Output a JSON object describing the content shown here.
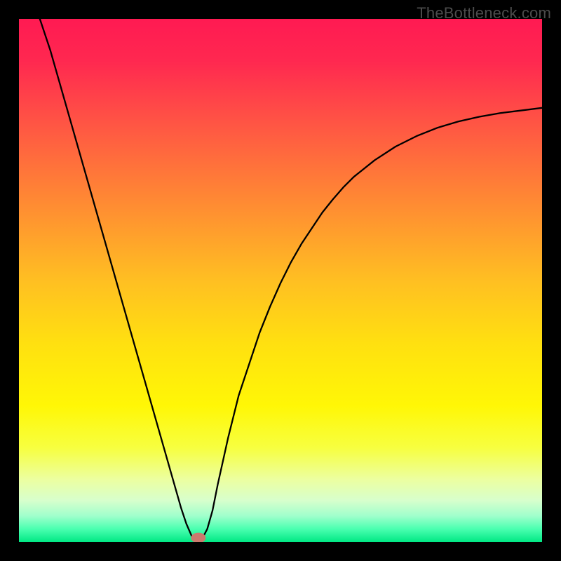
{
  "watermark": "TheBottleneck.com",
  "chart_data": {
    "type": "line",
    "title": "",
    "xlabel": "",
    "ylabel": "",
    "xlim": [
      0,
      100
    ],
    "ylim": [
      0,
      100
    ],
    "grid": false,
    "legend": false,
    "background": {
      "type": "vertical-gradient",
      "stops": [
        {
          "pos": 0.0,
          "color": "#ff1a52"
        },
        {
          "pos": 0.08,
          "color": "#ff2850"
        },
        {
          "pos": 0.2,
          "color": "#ff5544"
        },
        {
          "pos": 0.35,
          "color": "#ff8a33"
        },
        {
          "pos": 0.5,
          "color": "#ffbf22"
        },
        {
          "pos": 0.62,
          "color": "#ffe010"
        },
        {
          "pos": 0.74,
          "color": "#fff706"
        },
        {
          "pos": 0.82,
          "color": "#f7ff40"
        },
        {
          "pos": 0.88,
          "color": "#ecffa0"
        },
        {
          "pos": 0.92,
          "color": "#d8ffcc"
        },
        {
          "pos": 0.95,
          "color": "#a0ffcc"
        },
        {
          "pos": 0.975,
          "color": "#4affb0"
        },
        {
          "pos": 1.0,
          "color": "#00e884"
        }
      ]
    },
    "series": [
      {
        "name": "bottleneck-curve",
        "color": "#000000",
        "stroke_width": 2.3,
        "x": [
          4,
          6,
          8,
          10,
          12,
          14,
          16,
          18,
          20,
          22,
          24,
          26,
          28,
          29,
          30,
          31,
          32,
          33,
          34,
          35,
          36,
          37,
          38,
          40,
          42,
          44,
          46,
          48,
          50,
          52,
          54,
          56,
          58,
          60,
          62,
          64,
          68,
          72,
          76,
          80,
          84,
          88,
          92,
          96,
          100
        ],
        "y": [
          100,
          94,
          87,
          80,
          73,
          66,
          59,
          52,
          45,
          38,
          31,
          24,
          17,
          13.5,
          10,
          6.5,
          3.5,
          1.2,
          0.3,
          0.6,
          2.5,
          6,
          11,
          20,
          28,
          34,
          40,
          45,
          49.5,
          53.5,
          57,
          60,
          63,
          65.5,
          67.8,
          69.8,
          73,
          75.6,
          77.6,
          79.2,
          80.4,
          81.3,
          82,
          82.5,
          83
        ]
      }
    ],
    "marker": {
      "name": "optimal-point",
      "x": 34.3,
      "y": 0.8,
      "rx": 1.4,
      "ry": 1.0,
      "fill": "#cb7a6d"
    }
  }
}
